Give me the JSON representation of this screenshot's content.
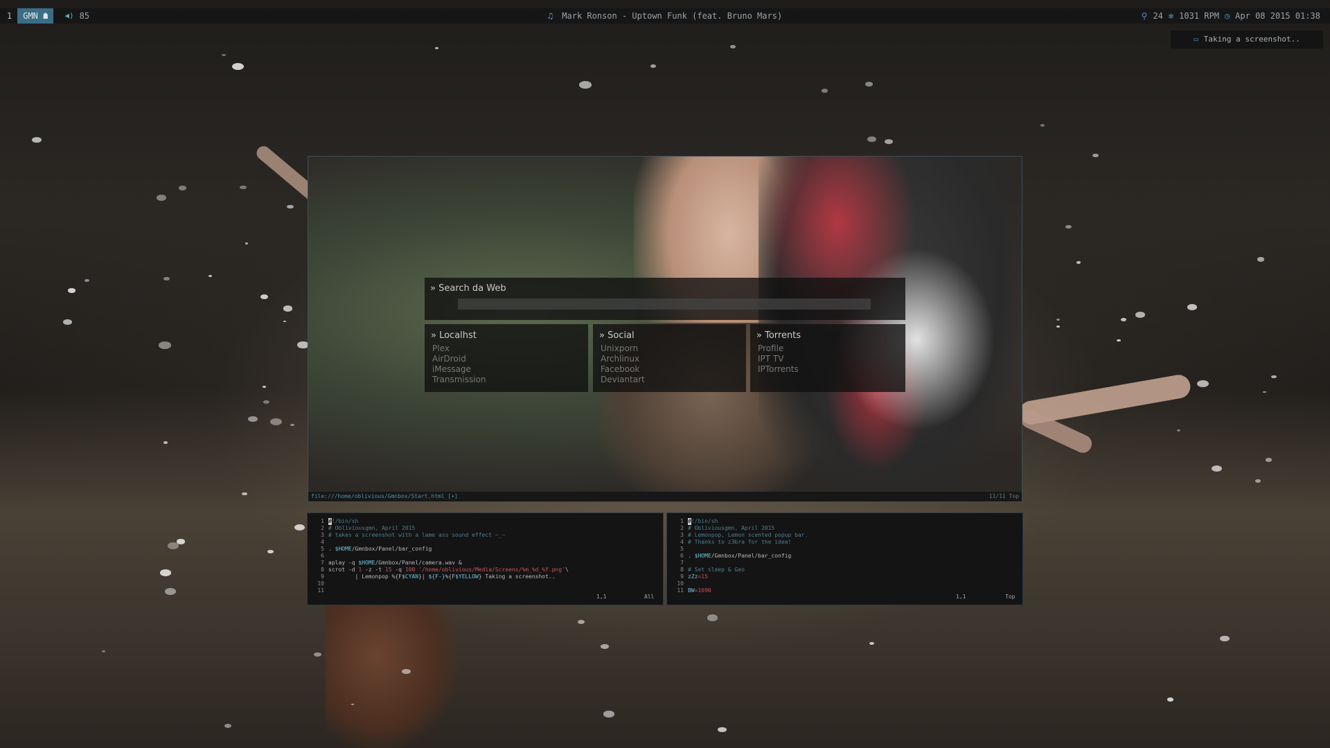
{
  "bar": {
    "workspace_number": "1",
    "active_tag": "GMN ☗",
    "volume": "85",
    "now_playing": "Mark Ronson - Uptown Funk (feat. Bruno Mars)",
    "right": {
      "temp": "24",
      "fan": "1031 RPM",
      "datetime": "Apr 08 2015 01:38"
    },
    "icons": {
      "volume": "speaker-icon",
      "music": "headphones-icon",
      "temp": "thermometer-icon",
      "fan": "fan-icon",
      "clock": "clock-icon"
    }
  },
  "notification": {
    "text": "Taking a screenshot.."
  },
  "browser": {
    "search": {
      "title": "» Search da Web",
      "value": ""
    },
    "panels": [
      {
        "title": "» Localhst",
        "links": [
          "Plex",
          "AirDroid",
          "iMessage",
          "Transmission"
        ]
      },
      {
        "title": "» Social",
        "links": [
          "Unixporn",
          "Archlinux",
          "Facebook",
          "Deviantart"
        ]
      },
      {
        "title": "» Torrents",
        "links": [
          "Profile",
          "IPT TV",
          "IPTorrents"
        ]
      }
    ],
    "status": {
      "url": "file:///home/oblivious/Gmnbox/Start.html [+]",
      "position": "11/11 Top"
    }
  },
  "terminals": [
    {
      "lines": [
        {
          "n": "1",
          "segs": [
            {
              "t": "#",
              "c": "cursor"
            },
            {
              "t": "!/bin/sh",
              "c": "c-comment"
            }
          ]
        },
        {
          "n": "2",
          "segs": [
            {
              "t": "# Obliviousgmn, April 2015",
              "c": "c-comment"
            }
          ]
        },
        {
          "n": "3",
          "segs": [
            {
              "t": "# takes a screenshot with a lame ass sound effect ~_~",
              "c": "c-comment"
            }
          ]
        },
        {
          "n": "4",
          "segs": []
        },
        {
          "n": "5",
          "segs": [
            {
              "t": ". ",
              "c": ""
            },
            {
              "t": "$HOME",
              "c": "c-cyan"
            },
            {
              "t": "/Gmnbox/Panel/bar_config",
              "c": ""
            }
          ]
        },
        {
          "n": "6",
          "segs": []
        },
        {
          "n": "7",
          "segs": [
            {
              "t": "aplay -q ",
              "c": ""
            },
            {
              "t": "$HOME",
              "c": "c-cyan"
            },
            {
              "t": "/Gmnbox/Panel/camera.wav &",
              "c": ""
            }
          ]
        },
        {
          "n": "8",
          "segs": [
            {
              "t": "scrot -d ",
              "c": ""
            },
            {
              "t": "1",
              "c": "c-red"
            },
            {
              "t": " -z -t ",
              "c": ""
            },
            {
              "t": "15",
              "c": "c-red"
            },
            {
              "t": " -q ",
              "c": ""
            },
            {
              "t": "100",
              "c": "c-red"
            },
            {
              "t": " '/home/oblivious/Media/Screens/%m_%d_%Y.png'",
              "c": "c-red"
            },
            {
              "t": "\\",
              "c": ""
            }
          ]
        },
        {
          "n": "9",
          "segs": [
            {
              "t": "        | Lemonpop %{F",
              "c": ""
            },
            {
              "t": "$CYAN",
              "c": "c-cyan"
            },
            {
              "t": "}| ",
              "c": ""
            },
            {
              "t": "${F-}",
              "c": "c-cyan"
            },
            {
              "t": "%{F",
              "c": ""
            },
            {
              "t": "$YELLOW",
              "c": "c-cyan"
            },
            {
              "t": "} Taking a screenshot..",
              "c": ""
            }
          ]
        },
        {
          "n": "10",
          "segs": []
        },
        {
          "n": "11",
          "segs": []
        }
      ],
      "cursor_pos": "1,1",
      "scroll": "All"
    },
    {
      "lines": [
        {
          "n": "1",
          "segs": [
            {
              "t": "#",
              "c": "cursor"
            },
            {
              "t": "!/bin/sh",
              "c": "c-comment"
            }
          ]
        },
        {
          "n": "2",
          "segs": [
            {
              "t": "# Obliviousgmn, April 2015",
              "c": "c-comment"
            }
          ]
        },
        {
          "n": "3",
          "segs": [
            {
              "t": "# Lemonpop, Lemon scented popup bar.",
              "c": "c-comment"
            }
          ]
        },
        {
          "n": "4",
          "segs": [
            {
              "t": "# Thanks to z3bra for the idea!",
              "c": "c-comment"
            }
          ]
        },
        {
          "n": "5",
          "segs": []
        },
        {
          "n": "6",
          "segs": [
            {
              "t": ". ",
              "c": ""
            },
            {
              "t": "$HOME",
              "c": "c-cyan"
            },
            {
              "t": "/Gmnbox/Panel/bar_config",
              "c": ""
            }
          ]
        },
        {
          "n": "7",
          "segs": []
        },
        {
          "n": "8",
          "segs": [
            {
              "t": "# Set sleep & Geo",
              "c": "c-comment"
            }
          ]
        },
        {
          "n": "9",
          "segs": [
            {
              "t": "zZz",
              "c": "c-cyan"
            },
            {
              "t": "=15",
              "c": "c-red"
            }
          ]
        },
        {
          "n": "10",
          "segs": []
        },
        {
          "n": "11",
          "segs": [
            {
              "t": "BW",
              "c": "c-cyan"
            },
            {
              "t": "=1690",
              "c": "c-red"
            }
          ]
        }
      ],
      "cursor_pos": "1,1",
      "scroll": "Top"
    }
  ]
}
